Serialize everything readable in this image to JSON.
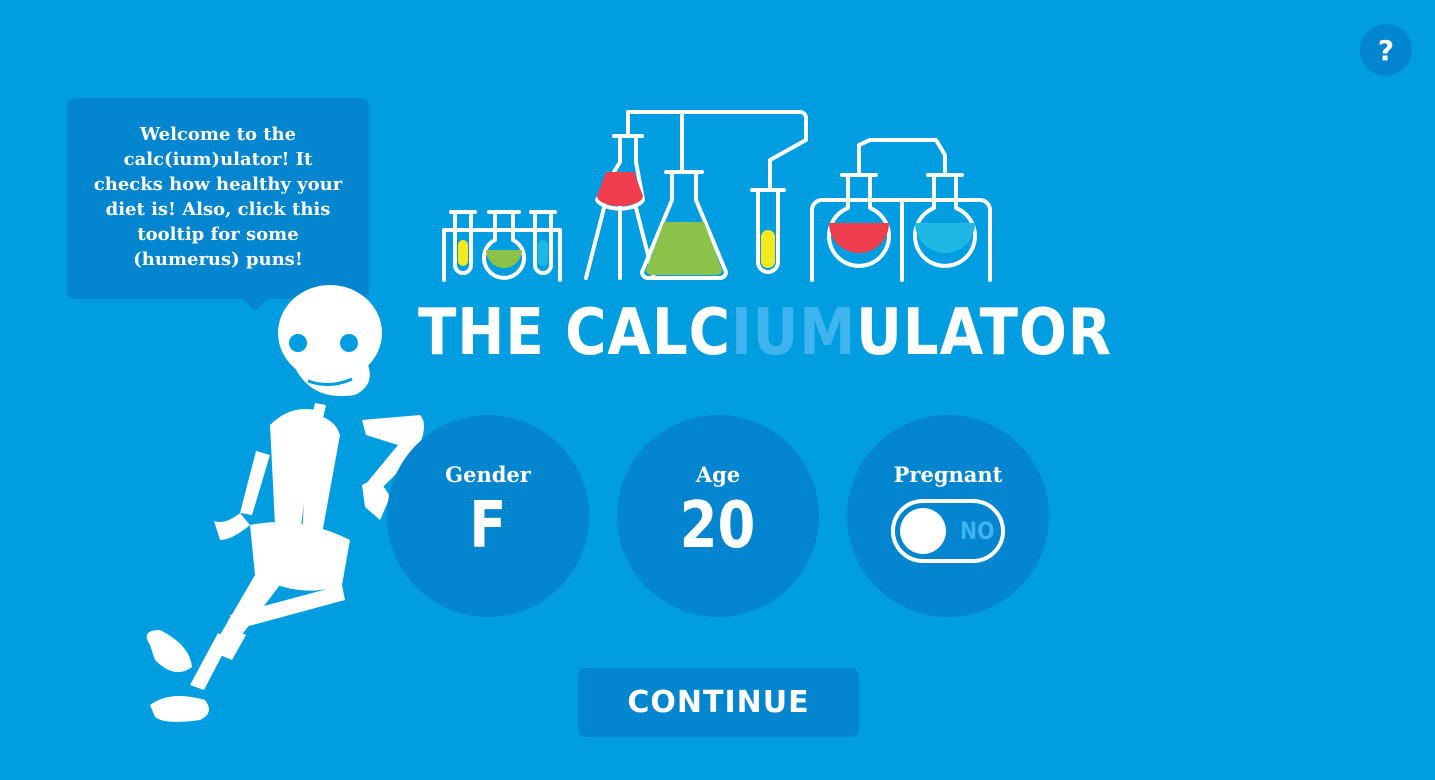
{
  "help": {
    "label": "?"
  },
  "tooltip": {
    "text": "Welcome to the calc(ium)ulator! It checks how healthy your diet is! Also, click this tooltip for some (humerus) puns!"
  },
  "title": {
    "part1": "THE CALC",
    "highlight": "IUM",
    "part2": "ULATOR"
  },
  "inputs": {
    "gender": {
      "label": "Gender",
      "value": "F"
    },
    "age": {
      "label": "Age",
      "value": "20"
    },
    "pregnant": {
      "label": "Pregnant",
      "state": "NO",
      "on": false
    }
  },
  "continue": {
    "label": "CONTINUE"
  },
  "colors": {
    "background": "#009ee0",
    "panel": "#0385cf",
    "highlight": "#3fb4ee",
    "liquid_red": "#ee3e4e",
    "liquid_green": "#8bc34a",
    "liquid_yellow": "#f5e81c",
    "liquid_cyan": "#1fb7e3"
  }
}
